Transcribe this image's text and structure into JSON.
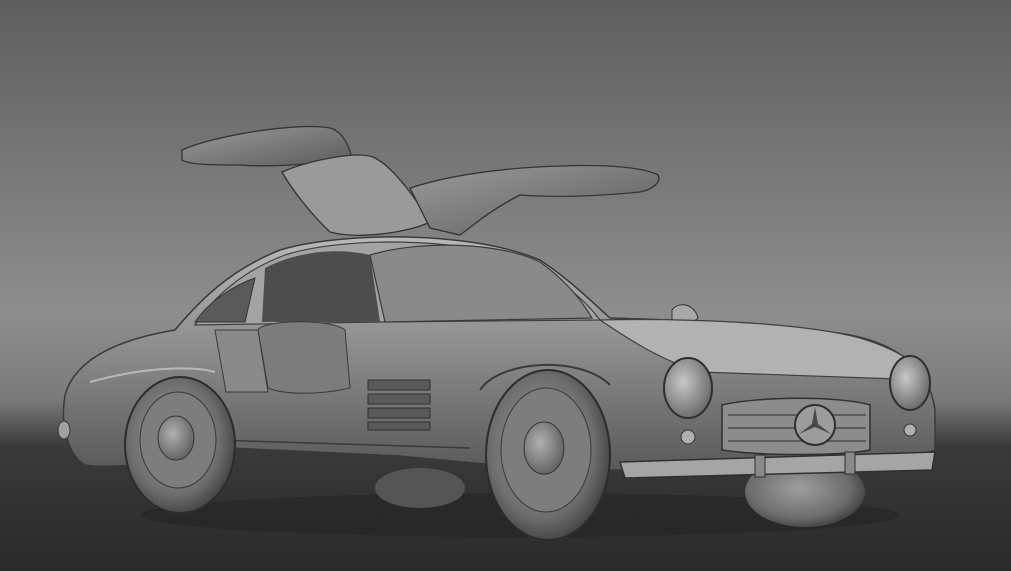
{
  "viewport": {
    "background_top": "#5f5f5f",
    "background_mid": "#8c8c8c",
    "background_bottom": "#2b2b2b",
    "border_color": "#5a5a5a"
  },
  "model": {
    "shading": "gray-default",
    "base_color": "#8f8f8f",
    "highlight_color": "#c4c4c4",
    "shadow_color": "#3a3a3a"
  }
}
